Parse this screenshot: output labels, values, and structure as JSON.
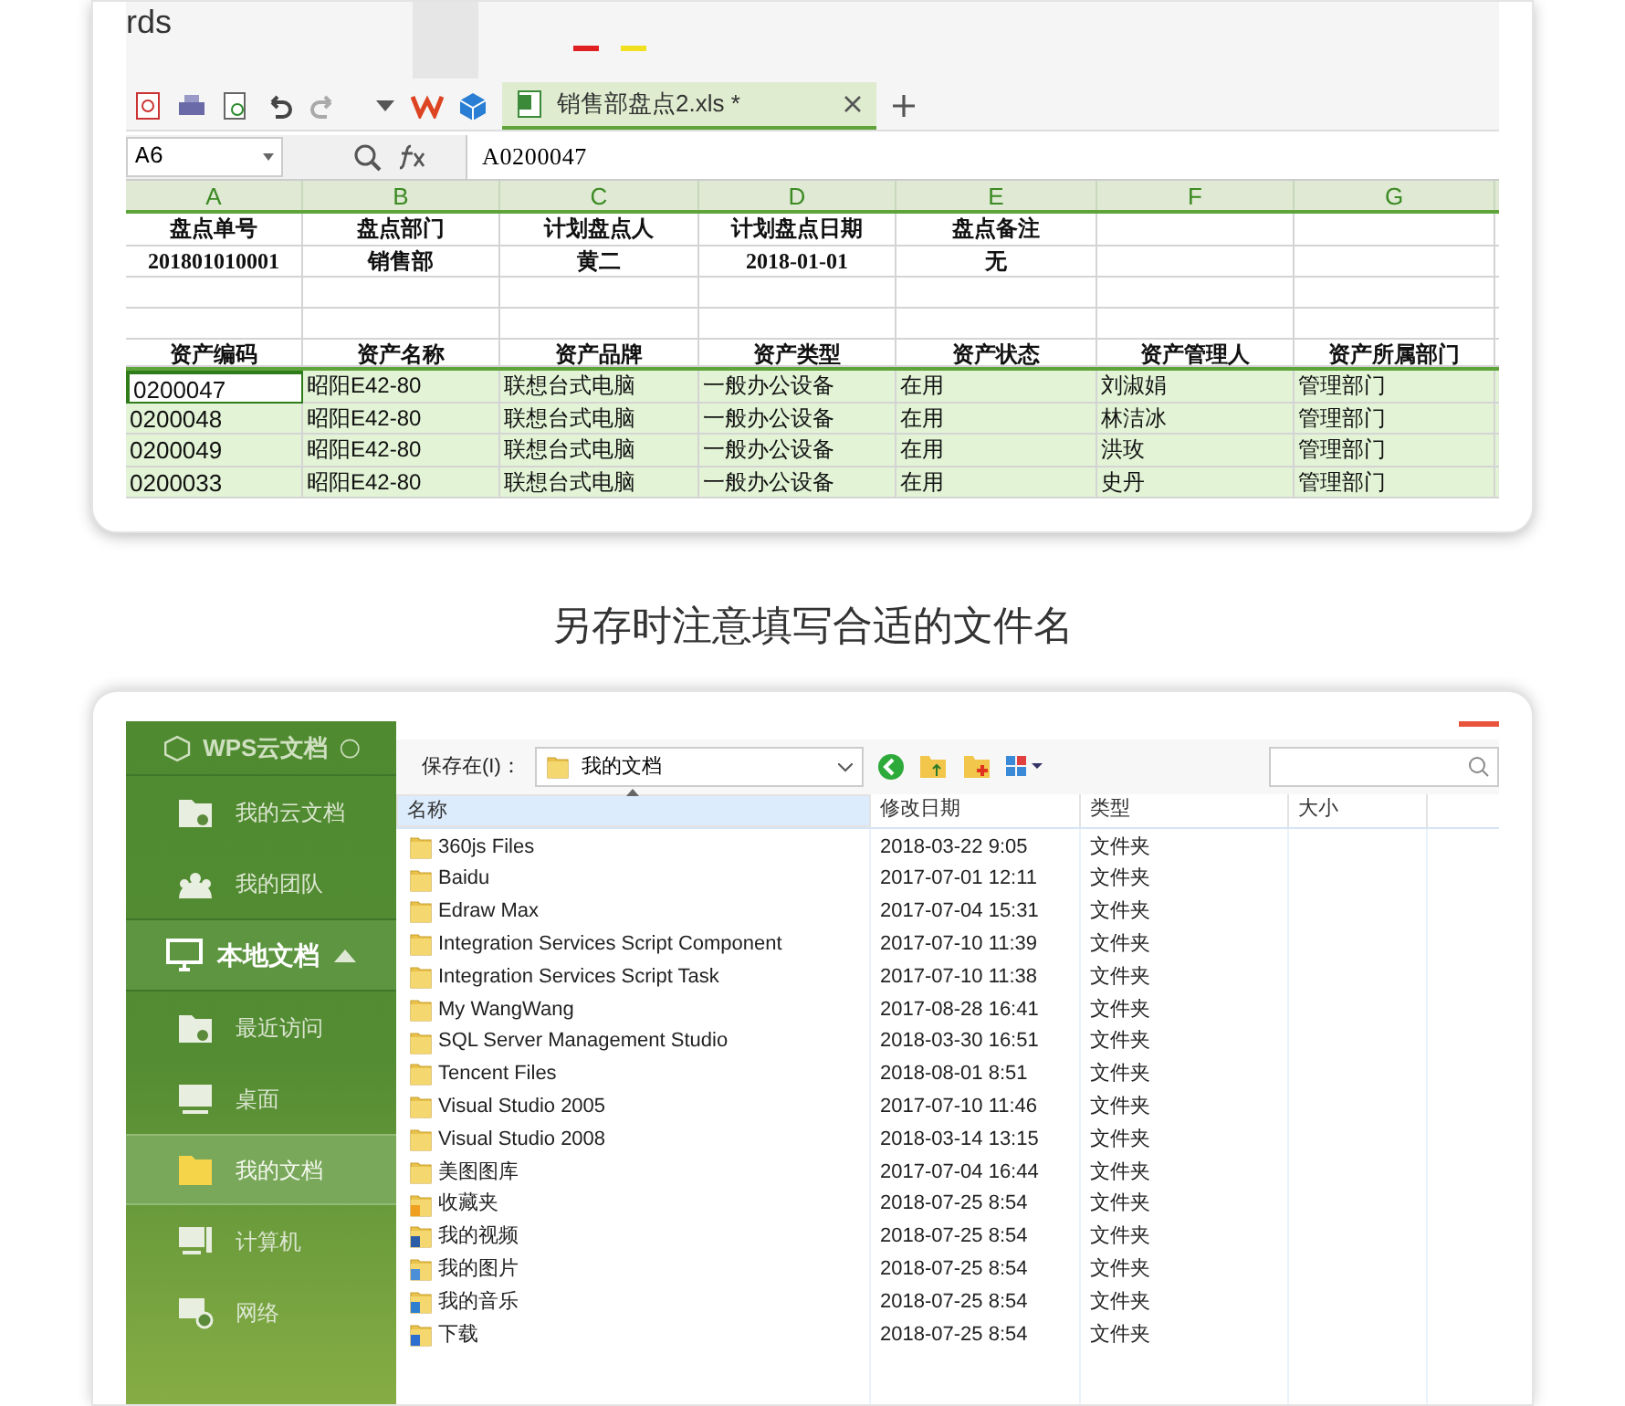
{
  "spreadsheet": {
    "ribbon_text": "rds",
    "tab": {
      "title": "销售部盘点2.xls *",
      "selected": true
    },
    "name_box": "A6",
    "formula": "A0200047",
    "columns": [
      "A",
      "B",
      "C",
      "D",
      "E",
      "F",
      "G"
    ],
    "rows": [
      {
        "kind": "header",
        "selected": false,
        "cells": [
          "盘点单号",
          "盘点部门",
          "计划盘点人",
          "计划盘点日期",
          "盘点备注",
          "",
          ""
        ]
      },
      {
        "kind": "value",
        "selected": false,
        "cells": [
          "201801010001",
          "销售部",
          "黄二",
          "2018-01-01",
          "无",
          "",
          ""
        ]
      },
      {
        "kind": "blank",
        "selected": false,
        "cells": [
          "",
          "",
          "",
          "",
          "",
          "",
          ""
        ]
      },
      {
        "kind": "blank",
        "selected": false,
        "cells": [
          "",
          "",
          "",
          "",
          "",
          "",
          ""
        ]
      },
      {
        "kind": "header",
        "selected": false,
        "cells": [
          "资产编码",
          "资产名称",
          "资产品牌",
          "资产类型",
          "资产状态",
          "资产管理人",
          "资产所属部门"
        ]
      },
      {
        "kind": "data",
        "selected": true,
        "cells": [
          "0200047",
          "昭阳E42-80",
          "联想台式电脑",
          "一般办公设备",
          "在用",
          "刘淑娟",
          "管理部门"
        ]
      },
      {
        "kind": "data",
        "selected": false,
        "cells": [
          "0200048",
          "昭阳E42-80",
          "联想台式电脑",
          "一般办公设备",
          "在用",
          "林洁冰",
          "管理部门"
        ]
      },
      {
        "kind": "data",
        "selected": false,
        "cells": [
          "0200049",
          "昭阳E42-80",
          "联想台式电脑",
          "一般办公设备",
          "在用",
          "洪玫",
          "管理部门"
        ]
      },
      {
        "kind": "data",
        "selected": false,
        "cells": [
          "0200033",
          "昭阳E42-80",
          "联想台式电脑",
          "一般办公设备",
          "在用",
          "史丹",
          "管理部门"
        ]
      }
    ]
  },
  "caption": "另存时注意填写合适的文件名",
  "save_dialog": {
    "sidebar": {
      "title": "WPS云文档",
      "items": [
        {
          "kind": "cloud",
          "label": "我的云文档",
          "selected": false
        },
        {
          "kind": "team",
          "label": "我的团队",
          "selected": false
        },
        {
          "kind": "section",
          "label": "本地文档",
          "expanded": true,
          "selected": false
        },
        {
          "kind": "recent",
          "label": "最近访问",
          "selected": false
        },
        {
          "kind": "desktop",
          "label": "桌面",
          "selected": false
        },
        {
          "kind": "documents",
          "label": "我的文档",
          "selected": true
        },
        {
          "kind": "computer",
          "label": "计算机",
          "selected": false
        },
        {
          "kind": "network",
          "label": "网络",
          "selected": false
        }
      ]
    },
    "save_in_label": "保存在(I)：",
    "location": "我的文档",
    "columns": [
      "名称",
      "修改日期",
      "类型",
      "大小"
    ],
    "files": [
      {
        "kind": "folder",
        "name": "360js Files",
        "date": "2018-03-22 9:05",
        "type": "文件夹"
      },
      {
        "kind": "folder",
        "name": "Baidu",
        "date": "2017-07-01 12:11",
        "type": "文件夹"
      },
      {
        "kind": "folder",
        "name": "Edraw Max",
        "date": "2017-07-04 15:31",
        "type": "文件夹"
      },
      {
        "kind": "folder",
        "name": "Integration Services Script Component",
        "date": "2017-07-10 11:39",
        "type": "文件夹"
      },
      {
        "kind": "folder",
        "name": "Integration Services Script Task",
        "date": "2017-07-10 11:38",
        "type": "文件夹"
      },
      {
        "kind": "folder",
        "name": "My WangWang",
        "date": "2017-08-28 16:41",
        "type": "文件夹"
      },
      {
        "kind": "folder",
        "name": "SQL Server Management Studio",
        "date": "2018-03-30 16:51",
        "type": "文件夹"
      },
      {
        "kind": "folder",
        "name": "Tencent Files",
        "date": "2018-08-01 8:51",
        "type": "文件夹"
      },
      {
        "kind": "folder",
        "name": "Visual Studio 2005",
        "date": "2017-07-10 11:46",
        "type": "文件夹"
      },
      {
        "kind": "folder",
        "name": "Visual Studio 2008",
        "date": "2018-03-14 13:15",
        "type": "文件夹"
      },
      {
        "kind": "folder",
        "name": "美图图库",
        "date": "2017-07-04 16:44",
        "type": "文件夹"
      },
      {
        "kind": "favorites",
        "name": "收藏夹",
        "date": "2018-07-25 8:54",
        "type": "文件夹"
      },
      {
        "kind": "video",
        "name": "我的视频",
        "date": "2018-07-25 8:54",
        "type": "文件夹"
      },
      {
        "kind": "pictures",
        "name": "我的图片",
        "date": "2018-07-25 8:54",
        "type": "文件夹"
      },
      {
        "kind": "music",
        "name": "我的音乐",
        "date": "2018-07-25 8:54",
        "type": "文件夹"
      },
      {
        "kind": "download",
        "name": "下载",
        "date": "2018-07-25 8:54",
        "type": "文件夹"
      }
    ]
  }
}
